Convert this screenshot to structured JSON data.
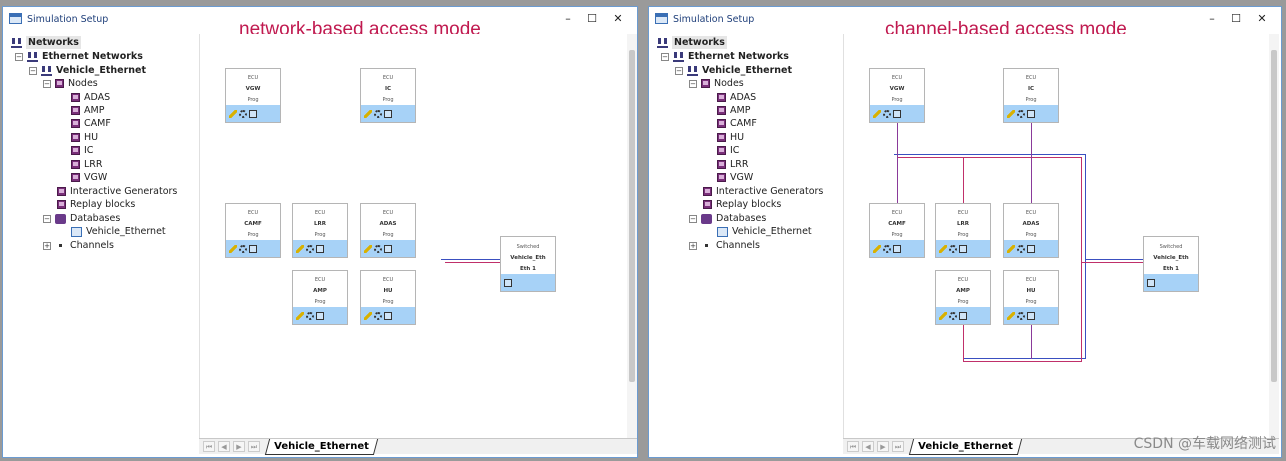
{
  "windows": [
    {
      "title": "Simulation Setup",
      "caption": "network-based access mode",
      "controls": {
        "minimize": "–",
        "maximize": "☐",
        "close": "✕"
      },
      "tree": {
        "root": "Networks",
        "ethernet_networks": "Ethernet Networks",
        "vehicle_ethernet": "Vehicle_Ethernet",
        "nodes": "Nodes",
        "node_list": [
          "ADAS",
          "AMP",
          "CAMF",
          "HU",
          "IC",
          "LRR",
          "VGW"
        ],
        "interactive_generators": "Interactive Generators",
        "replay_blocks": "Replay blocks",
        "databases": "Databases",
        "database_item": "Vehicle_Ethernet",
        "channels": "Channels",
        "toggle_minus": "−",
        "toggle_plus": "+"
      },
      "ecus": [
        {
          "type": "ECU",
          "name": "VGW",
          "sub": "Prog"
        },
        {
          "type": "ECU",
          "name": "IC",
          "sub": "Prog"
        },
        {
          "type": "ECU",
          "name": "CAMF",
          "sub": "Prog"
        },
        {
          "type": "ECU",
          "name": "LRR",
          "sub": "Prog"
        },
        {
          "type": "ECU",
          "name": "ADAS",
          "sub": "Prog"
        },
        {
          "type": "ECU",
          "name": "AMP",
          "sub": "Prog"
        },
        {
          "type": "ECU",
          "name": "HU",
          "sub": "Prog"
        }
      ],
      "switch": {
        "type": "Switched",
        "name": "Vehicle_Eth",
        "port": "Eth 1"
      },
      "tab": "Vehicle_Ethernet",
      "nav": [
        "⏮",
        "◀",
        "▶",
        "⏭"
      ]
    },
    {
      "title": "Simulation Setup",
      "caption": "channel-based access mode",
      "controls": {
        "minimize": "–",
        "maximize": "☐",
        "close": "✕"
      },
      "tree": {
        "root": "Networks",
        "ethernet_networks": "Ethernet Networks",
        "vehicle_ethernet": "Vehicle_Ethernet",
        "nodes": "Nodes",
        "node_list": [
          "ADAS",
          "AMP",
          "CAMF",
          "HU",
          "IC",
          "LRR",
          "VGW"
        ],
        "interactive_generators": "Interactive Generators",
        "replay_blocks": "Replay blocks",
        "databases": "Databases",
        "database_item": "Vehicle_Ethernet",
        "channels": "Channels",
        "toggle_minus": "−",
        "toggle_plus": "+"
      },
      "ecus": [
        {
          "type": "ECU",
          "name": "VGW",
          "sub": "Prog"
        },
        {
          "type": "ECU",
          "name": "IC",
          "sub": "Prog"
        },
        {
          "type": "ECU",
          "name": "CAMF",
          "sub": "Prog"
        },
        {
          "type": "ECU",
          "name": "LRR",
          "sub": "Prog"
        },
        {
          "type": "ECU",
          "name": "ADAS",
          "sub": "Prog"
        },
        {
          "type": "ECU",
          "name": "AMP",
          "sub": "Prog"
        },
        {
          "type": "ECU",
          "name": "HU",
          "sub": "Prog"
        }
      ],
      "switch": {
        "type": "Switched",
        "name": "Vehicle_Eth",
        "port": "Eth 1"
      },
      "tab": "Vehicle_Ethernet",
      "nav": [
        "⏮",
        "◀",
        "▶",
        "⏭"
      ]
    }
  ],
  "watermark": "CSDN @车载网络测试",
  "colors": {
    "accent": "#c0194f",
    "bar": "#a7d2f7",
    "wire_red": "#c0306a",
    "wire_blue": "#3a4fc0"
  }
}
